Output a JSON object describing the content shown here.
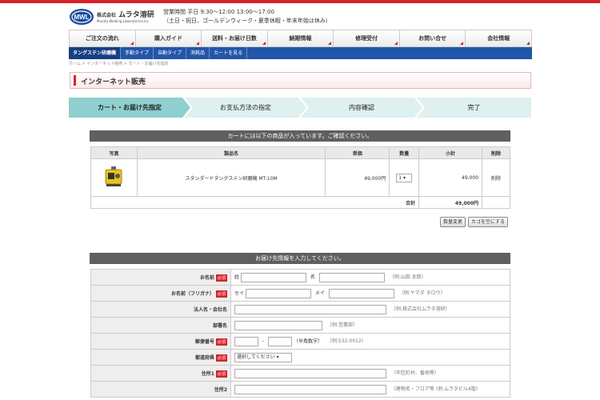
{
  "header": {
    "company": "株式会社 ムラタ溶研",
    "company_small": "株式会社",
    "company_main": "ムラタ溶研",
    "company_en": "Murata Welding Laboratories,Inc",
    "hours_line1": "営業時間 平日 9:30〜12:00 13:00〜17:00",
    "hours_line2": "（土日・祝日、ゴールデンウィーク・夏季休暇・年末年始は休み）"
  },
  "main_nav": [
    {
      "label": "ご注文の流れ"
    },
    {
      "label": "購入ガイド"
    },
    {
      "label": "送料・お届け日数"
    },
    {
      "label": "納期情報"
    },
    {
      "label": "修理受付"
    },
    {
      "label": "お問い合せ"
    },
    {
      "label": "会社情報"
    }
  ],
  "sub_nav": [
    {
      "label": "タングステン研磨機"
    },
    {
      "label": "手動タイプ"
    },
    {
      "label": "自動タイプ"
    },
    {
      "label": "消耗品"
    },
    {
      "label": "カートを見る"
    }
  ],
  "breadcrumb": "ホーム > インターネット販売 > カート・お届け先指定",
  "page_title": "インターネット販売",
  "steps": [
    {
      "label": "カート・お届け先指定"
    },
    {
      "label": "お支払方法の指定"
    },
    {
      "label": "内容確認"
    },
    {
      "label": "完了"
    }
  ],
  "cart": {
    "heading": "カートには以下の商品が入っています。ご確認ください。",
    "headers": {
      "photo": "写真",
      "name": "製品名",
      "price": "単価",
      "qty": "数量",
      "subtotal": "小計",
      "delete": "削除"
    },
    "item": {
      "name": "スタンダードタングステン研磨機 MT-10M",
      "price": "49,000円",
      "qty": "1",
      "subtotal": "49,000",
      "delete": "削除"
    },
    "total_label": "合計",
    "total_value": "49,000円",
    "update_button": "数量変更",
    "empty_button": "カゴを空にする"
  },
  "delivery": {
    "heading": "お届け先情報を入力してください。",
    "required_label": "必須",
    "name": {
      "label": "お名前",
      "sei": "姓",
      "mei": "名",
      "example": "（例:山田 太郎）"
    },
    "kana": {
      "label": "お名前（フリガナ）",
      "sei": "セイ",
      "mei": "メイ",
      "example": "（例:ヤマダ タロウ）"
    },
    "corp": {
      "label": "法人名・会社名",
      "example": "（例:株式会社ムラタ溶研）"
    },
    "dept": {
      "label": "部署名",
      "example": "（例:営業部）"
    },
    "zip": {
      "label": "郵便番号",
      "dash": "-",
      "note": "（半角数字）",
      "example": "（例:532-0012）"
    },
    "pref": {
      "label": "都道府県",
      "value": "選択してください"
    },
    "addr1": {
      "label": "住所1",
      "example": "（市区町村、番地等）"
    },
    "addr2": {
      "label": "住所2",
      "example": "（建物名・フロア等 (例:ムラタビル4階)"
    }
  },
  "colors": {
    "brand_red": "#d7222a",
    "nav_blue": "#2256a8",
    "step_active": "#8fcfcf",
    "step_inactive": "#dff0f0",
    "section_head": "#5f5f5f"
  }
}
